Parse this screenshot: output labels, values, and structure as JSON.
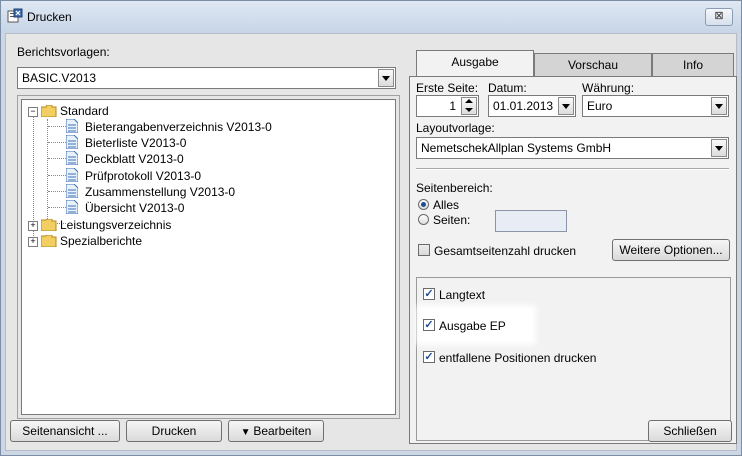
{
  "window": {
    "title": "Drucken",
    "close_symbol": "⊠"
  },
  "left": {
    "templates_label": "Berichtsvorlagen:",
    "templates_value": "BASIC.V2013",
    "tree": {
      "root": "Standard",
      "children": [
        "Bieterangabenverzeichnis V2013-0",
        "Bieterliste V2013-0",
        "Deckblatt V2013-0",
        "Prüfprotokoll V2013-0",
        "Zusammenstellung V2013-0",
        "Übersicht V2013-0"
      ],
      "other_roots": [
        "Leistungsverzeichnis",
        "Spezialberichte"
      ]
    }
  },
  "tabs": [
    "Ausgabe",
    "Vorschau",
    "Info"
  ],
  "output": {
    "first_page_label": "Erste Seite:",
    "first_page_value": "1",
    "date_label": "Datum:",
    "date_value": "01.01.2013",
    "currency_label": "Währung:",
    "currency_value": "Euro",
    "layout_label": "Layoutvorlage:",
    "layout_value": "NemetschekAllplan Systems GmbH",
    "range_label": "Seitenbereich:",
    "range_all": "Alles",
    "range_pages": "Seiten:",
    "total_pages_label": "Gesamtseitenzahl drucken",
    "more_options": "Weitere Optionen...",
    "longtext_label": "Langtext",
    "output_ep_label": "Ausgabe EP",
    "omitted_label": "entfallene Positionen drucken"
  },
  "footer": {
    "page_view": "Seitenansicht ...",
    "print": "Drucken",
    "edit": "Bearbeiten",
    "close": "Schließen"
  }
}
